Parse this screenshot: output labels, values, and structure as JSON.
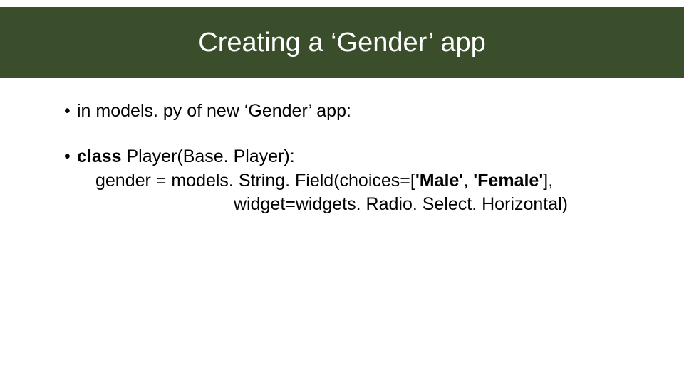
{
  "title": "Creating a ‘Gender’ app",
  "bullets": [
    {
      "line1": "in models. py of new ‘Gender’ app:"
    },
    {
      "class_kw": "class",
      "class_rest": " Player(Base. Player):",
      "line2_pre": "gender = models. String. Field(choices=[",
      "choice1": "'Male'",
      "comma": ", ",
      "choice2": "'Female'",
      "line2_post": "],",
      "line3": "widget=widgets. Radio. Select. Horizontal)"
    }
  ]
}
